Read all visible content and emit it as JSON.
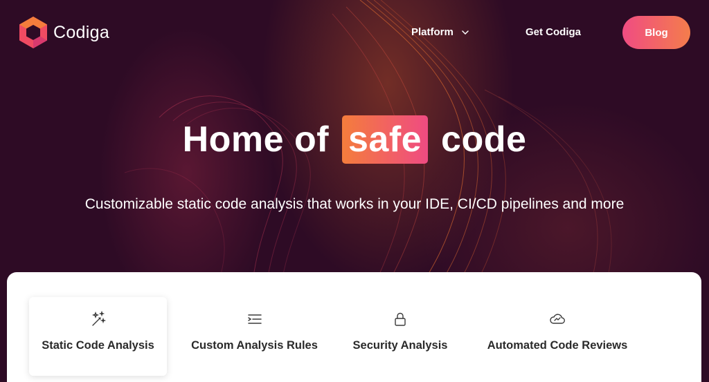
{
  "brand": {
    "name": "Codiga",
    "colors": {
      "accent_pink": "#ef4b82",
      "accent_orange": "#f47d3c",
      "background": "#2e0b25"
    }
  },
  "nav": {
    "platform_label": "Platform",
    "get_label": "Get Codiga",
    "blog_label": "Blog"
  },
  "hero": {
    "headline_before": "Home of",
    "headline_highlight": "safe",
    "headline_after": "code",
    "subheadline": "Customizable static code analysis that works in your IDE, CI/CD pipelines and more"
  },
  "tabs": [
    {
      "label": "Static Code Analysis",
      "icon": "magic-wand-icon",
      "active": true
    },
    {
      "label": "Custom Analysis Rules",
      "icon": "indent-lines-icon",
      "active": false
    },
    {
      "label": "Security Analysis",
      "icon": "lock-icon",
      "active": false
    },
    {
      "label": "Automated Code Reviews",
      "icon": "cloud-icon",
      "active": false
    }
  ]
}
